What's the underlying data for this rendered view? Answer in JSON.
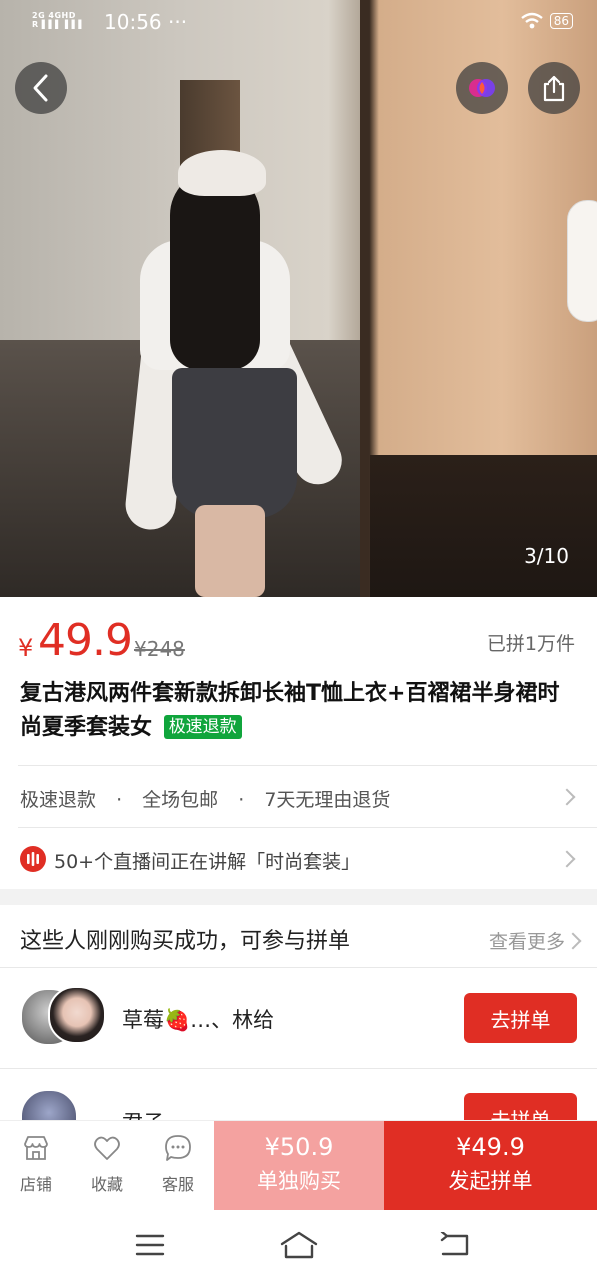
{
  "status_bar": {
    "net_line1": "2G  4GHD",
    "net_line2": "R▐▐▐ ▐▐▐",
    "time": "10:56",
    "dots": "···",
    "battery": "86"
  },
  "gallery": {
    "counter": "3/10"
  },
  "product": {
    "price_symbol": "¥",
    "price": "49.9",
    "original_price": "¥248",
    "sold": "已拼1万件",
    "title": "复古港风两件套新款拆卸长袖T恤上衣+百褶裙半身裙时尚夏季套装女",
    "badge": "极速退款"
  },
  "services": {
    "items": [
      "极速退款",
      "全场包邮",
      "7天无理由退货"
    ],
    "separator": "·"
  },
  "live": {
    "text": "50+个直播间正在讲解「时尚套装」"
  },
  "group_buy": {
    "title": "这些人刚刚购买成功，可参与拼单",
    "more": "查看更多",
    "entries": [
      {
        "name": "草莓🍓…、林给",
        "button": "去拼单"
      },
      {
        "name": "君子",
        "button": "去拼单"
      }
    ]
  },
  "bottom_bar": {
    "shop": "店铺",
    "favorite": "收藏",
    "service": "客服",
    "buy_alone_price": "¥50.9",
    "buy_alone_label": "单独购买",
    "buy_group_price": "¥49.9",
    "buy_group_label": "发起拼单"
  },
  "colors": {
    "accent": "#e02e24",
    "buy_alone_bg": "#f4a2a0",
    "badge_green": "#10a53c"
  }
}
